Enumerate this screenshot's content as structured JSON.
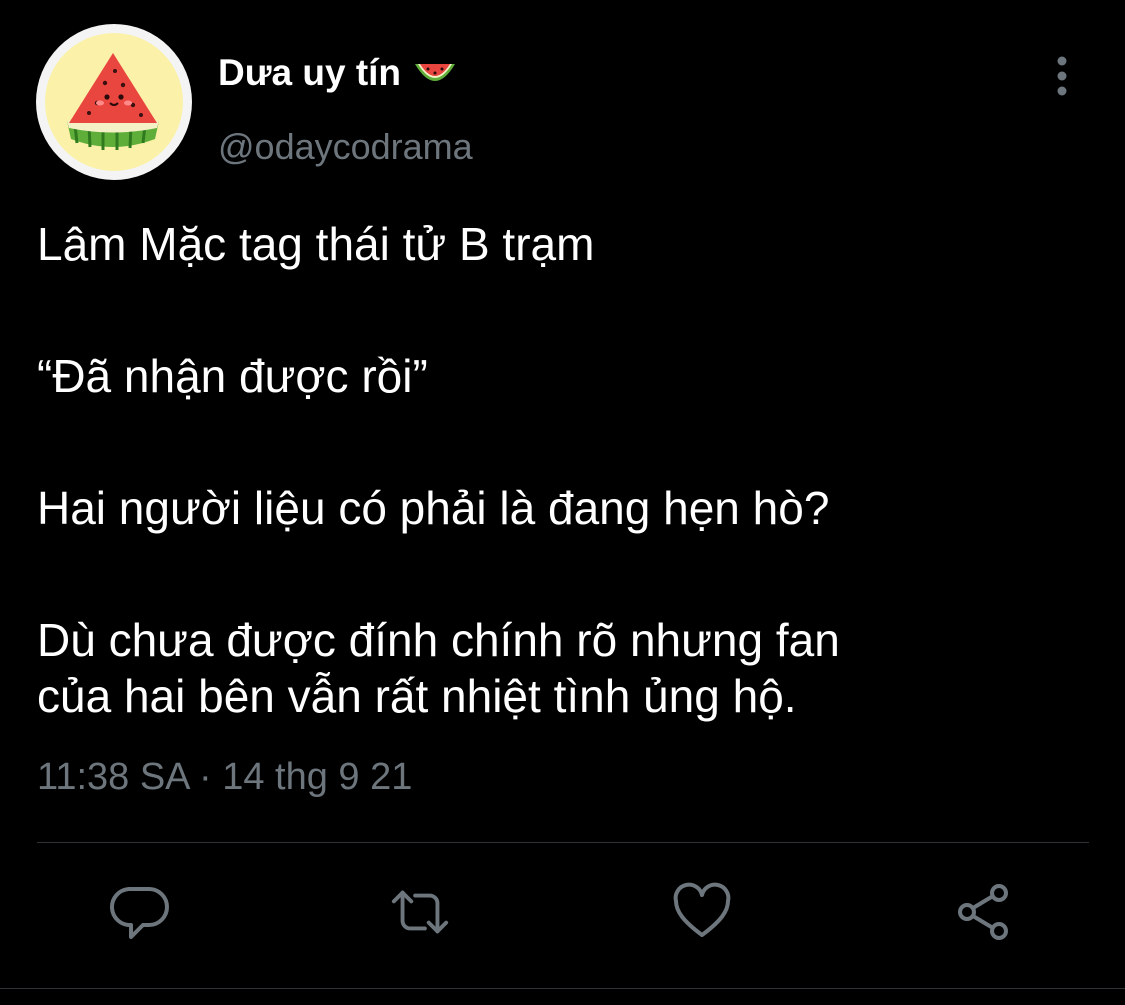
{
  "tweet": {
    "author": {
      "display_name": "Dưa uy tín",
      "name_emoji": "watermelon-emoji",
      "handle": "@odaycodrama",
      "avatar": "watermelon-slice-avatar"
    },
    "menu_icon": "more-vertical-icon",
    "lines": [
      "Lâm Mặc tag thái tử B trạm",
      "“Đã nhận được rồi”",
      "Hai người liệu có phải là đang hẹn hò?",
      "Dù chưa được đính chính rõ nhưng fan",
      "của hai bên vẫn rất nhiệt tình ủng hộ."
    ],
    "timestamp": "11:38 SA · 14 thg 9 21",
    "actions": [
      "reply-icon",
      "retweet-icon",
      "like-icon",
      "share-icon"
    ]
  },
  "colors": {
    "background": "#000000",
    "text": "#ffffff",
    "secondary_text": "#6e767d",
    "divider": "#2f3336"
  }
}
